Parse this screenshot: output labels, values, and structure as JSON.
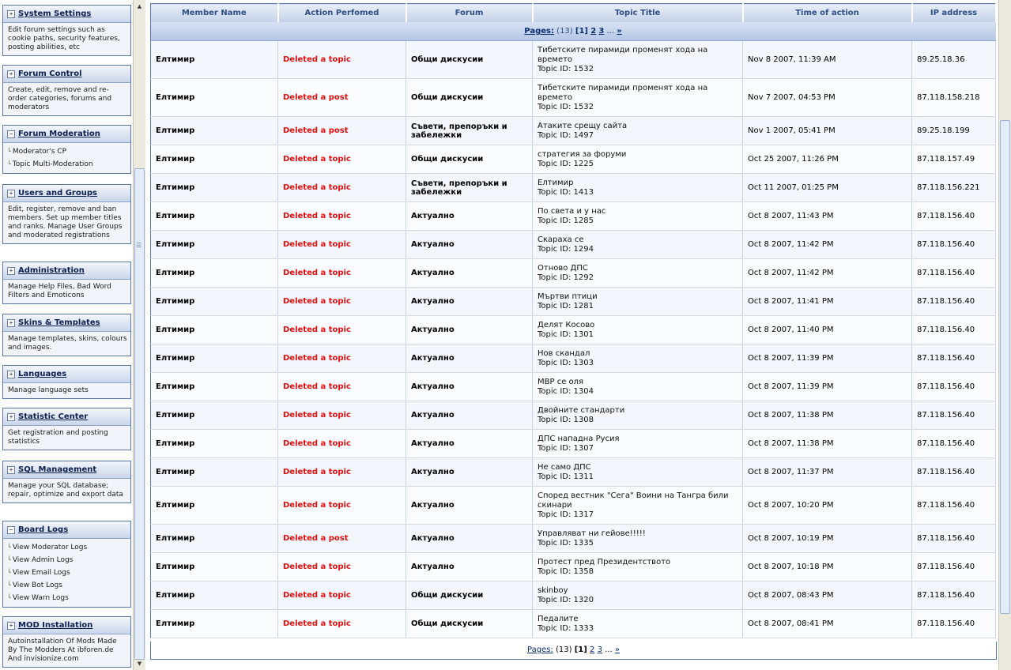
{
  "sidebar": {
    "boxes": [
      {
        "id": "system-settings",
        "toggle": "+",
        "title": "System Settings",
        "desc": "Edit forum settings such as cookie paths, security features, posting abilities, etc",
        "links": []
      },
      {
        "id": "forum-control",
        "toggle": "+",
        "title": "Forum Control",
        "desc": "Create, edit, remove and re-order categories, forums and moderators",
        "links": []
      },
      {
        "id": "forum-moderation",
        "toggle": "−",
        "title": "Forum Moderation",
        "desc": "",
        "links": [
          "Moderator's CP",
          "Topic Multi-Moderation"
        ]
      },
      {
        "id": "users-and-groups",
        "toggle": "+",
        "title": "Users and Groups",
        "desc": "Edit, register, remove and ban members. Set up member titles and ranks. Manage User Groups and moderated registrations",
        "links": []
      },
      {
        "id": "administration",
        "toggle": "+",
        "title": "Administration",
        "desc": "Manage Help Files, Bad Word Filters and Emoticons",
        "links": []
      },
      {
        "id": "skins-templates",
        "toggle": "+",
        "title": "Skins & Templates",
        "desc": "Manage templates, skins, colours and images.",
        "links": []
      },
      {
        "id": "languages",
        "toggle": "+",
        "title": "Languages",
        "desc": "Manage language sets",
        "links": []
      },
      {
        "id": "statistic-center",
        "toggle": "+",
        "title": "Statistic Center",
        "desc": "Get registration and posting statistics",
        "links": []
      },
      {
        "id": "sql-management",
        "toggle": "+",
        "title": "SQL Management",
        "desc": "Manage your SQL database; repair, optimize and export data",
        "links": []
      },
      {
        "id": "board-logs",
        "toggle": "−",
        "title": "Board Logs",
        "desc": "",
        "links": [
          "View Moderator Logs",
          "View Admin Logs",
          "View Email Logs",
          "View Bot Logs",
          "View Warn Logs"
        ]
      },
      {
        "id": "mod-installation",
        "toggle": "+",
        "title": "MOD Installation",
        "desc": "Autoinstallation Of Mods Made By The Modders At ibforen.de And invisionize.com",
        "links": []
      }
    ]
  },
  "table": {
    "headers": [
      "Member Name",
      "Action Perfomed",
      "Forum",
      "Topic Title",
      "Time of action",
      "IP address"
    ],
    "pager": {
      "label": "Pages:",
      "count": "(13)",
      "current": "[1]",
      "p2": "2",
      "p3": "3",
      "dots": "...",
      "next": "»"
    },
    "rows": [
      {
        "member": "Елтимир",
        "action": "Deleted a topic",
        "forum": "Общи дискусии",
        "title": "Тибетските пирамиди променят хода на времето",
        "topic_id": "Topic ID: 1532",
        "time": "Nov 8 2007, 11:39 AM",
        "ip": "89.25.18.36"
      },
      {
        "member": "Елтимир",
        "action": "Deleted a post",
        "forum": "Общи дискусии",
        "title": "Тибетските пирамиди променят хода на времето",
        "topic_id": "Topic ID: 1532",
        "time": "Nov 7 2007, 04:53 PM",
        "ip": "87.118.158.218"
      },
      {
        "member": "Елтимир",
        "action": "Deleted a post",
        "forum": "Съвети, препоръки и забележки",
        "title": "Атаките срещу сайта",
        "topic_id": "Topic ID: 1497",
        "time": "Nov 1 2007, 05:41 PM",
        "ip": "89.25.18.199"
      },
      {
        "member": "Елтимир",
        "action": "Deleted a topic",
        "forum": "Общи дискусии",
        "title": "стратегия за форуми",
        "topic_id": "Topic ID: 1225",
        "time": "Oct 25 2007, 11:26 PM",
        "ip": "87.118.157.49"
      },
      {
        "member": "Елтимир",
        "action": "Deleted a topic",
        "forum": "Съвети, препоръки и забележки",
        "title": "Елтимир",
        "topic_id": "Topic ID: 1413",
        "time": "Oct 11 2007, 01:25 PM",
        "ip": "87.118.156.221"
      },
      {
        "member": "Елтимир",
        "action": "Deleted a topic",
        "forum": "Актуално",
        "title": "По света и у нас",
        "topic_id": "Topic ID: 1285",
        "time": "Oct 8 2007, 11:43 PM",
        "ip": "87.118.156.40"
      },
      {
        "member": "Елтимир",
        "action": "Deleted a topic",
        "forum": "Актуално",
        "title": "Скараха се",
        "topic_id": "Topic ID: 1294",
        "time": "Oct 8 2007, 11:42 PM",
        "ip": "87.118.156.40"
      },
      {
        "member": "Елтимир",
        "action": "Deleted a topic",
        "forum": "Актуално",
        "title": "Отново ДПС",
        "topic_id": "Topic ID: 1292",
        "time": "Oct 8 2007, 11:42 PM",
        "ip": "87.118.156.40"
      },
      {
        "member": "Елтимир",
        "action": "Deleted a topic",
        "forum": "Актуално",
        "title": "Мъртви птици",
        "topic_id": "Topic ID: 1281",
        "time": "Oct 8 2007, 11:41 PM",
        "ip": "87.118.156.40"
      },
      {
        "member": "Елтимир",
        "action": "Deleted a topic",
        "forum": "Актуално",
        "title": "Делят Косово",
        "topic_id": "Topic ID: 1301",
        "time": "Oct 8 2007, 11:40 PM",
        "ip": "87.118.156.40"
      },
      {
        "member": "Елтимир",
        "action": "Deleted a topic",
        "forum": "Актуално",
        "title": "Нов скандал",
        "topic_id": "Topic ID: 1303",
        "time": "Oct 8 2007, 11:39 PM",
        "ip": "87.118.156.40"
      },
      {
        "member": "Елтимир",
        "action": "Deleted a topic",
        "forum": "Актуално",
        "title": "МВР се оля",
        "topic_id": "Topic ID: 1304",
        "time": "Oct 8 2007, 11:39 PM",
        "ip": "87.118.156.40"
      },
      {
        "member": "Елтимир",
        "action": "Deleted a topic",
        "forum": "Актуално",
        "title": "Двойните стандарти",
        "topic_id": "Topic ID: 1308",
        "time": "Oct 8 2007, 11:38 PM",
        "ip": "87.118.156.40"
      },
      {
        "member": "Елтимир",
        "action": "Deleted a topic",
        "forum": "Актуално",
        "title": "ДПС нападна Русия",
        "topic_id": "Topic ID: 1307",
        "time": "Oct 8 2007, 11:38 PM",
        "ip": "87.118.156.40"
      },
      {
        "member": "Елтимир",
        "action": "Deleted a topic",
        "forum": "Актуално",
        "title": "Не само ДПС",
        "topic_id": "Topic ID: 1311",
        "time": "Oct 8 2007, 11:37 PM",
        "ip": "87.118.156.40"
      },
      {
        "member": "Елтимир",
        "action": "Deleted a topic",
        "forum": "Актуално",
        "title": "Според вестник \"Сега\" Воини на Тангра били скинари",
        "topic_id": "Topic ID: 1317",
        "time": "Oct 8 2007, 10:20 PM",
        "ip": "87.118.156.40"
      },
      {
        "member": "Елтимир",
        "action": "Deleted a post",
        "forum": "Актуално",
        "title": "Управляват ни гейове!!!!!",
        "topic_id": "Topic ID: 1335",
        "time": "Oct 8 2007, 10:19 PM",
        "ip": "87.118.156.40"
      },
      {
        "member": "Елтимир",
        "action": "Deleted a topic",
        "forum": "Актуално",
        "title": "Протест пред Президентството",
        "topic_id": "Topic ID: 1358",
        "time": "Oct 8 2007, 10:18 PM",
        "ip": "87.118.156.40"
      },
      {
        "member": "Елтимир",
        "action": "Deleted a topic",
        "forum": "Общи дискусии",
        "title": "skinboy",
        "topic_id": "Topic ID: 1320",
        "time": "Oct 8 2007, 08:43 PM",
        "ip": "87.118.156.40"
      },
      {
        "member": "Елтимир",
        "action": "Deleted a topic",
        "forum": "Общи дискусии",
        "title": "Педалите",
        "topic_id": "Topic ID: 1333",
        "time": "Oct 8 2007, 08:41 PM",
        "ip": "87.118.156.40"
      }
    ]
  }
}
